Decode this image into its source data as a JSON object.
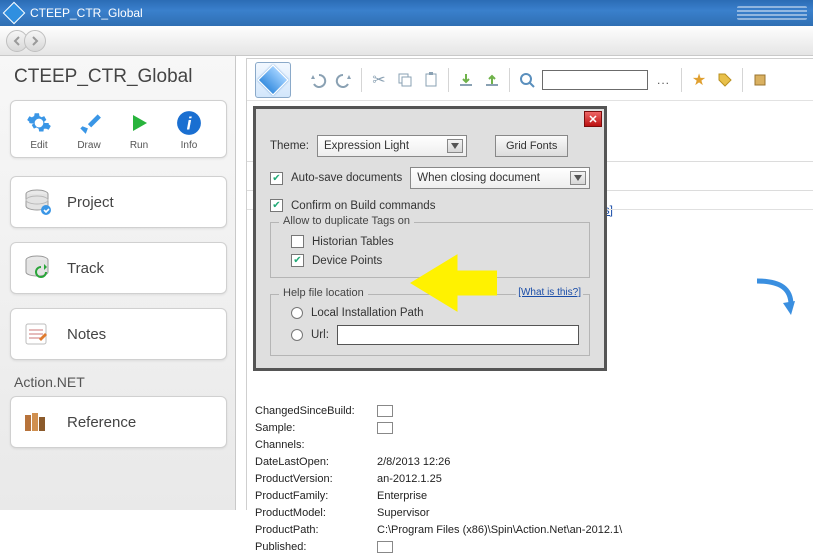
{
  "titlebar": {
    "title": "CTEEP_CTR_Global"
  },
  "left": {
    "title": "CTEEP_CTR_Global",
    "icons": {
      "edit": "Edit",
      "draw": "Draw",
      "run": "Run",
      "info": "Info"
    },
    "cards": {
      "project": "Project",
      "track": "Track",
      "notes": "Notes",
      "reference": "Reference"
    },
    "section": "Action.NET"
  },
  "toolbar": {
    "search_placeholder": "",
    "more": "..."
  },
  "pref": {
    "theme_label": "Theme:",
    "theme_value": "Expression Light",
    "grid_fonts": "Grid Fonts",
    "autosave": "Auto-save documents",
    "autosave_mode": "When closing document",
    "confirm": "Confirm on Build commands",
    "dup_label": "Allow to duplicate Tags on",
    "dup_hist": "Historian Tables",
    "dup_dev": "Device Points",
    "help_label": "Help file location",
    "what": "[What is this?]",
    "help_local": "Local Installation Path",
    "help_url": "Url:"
  },
  "info_link": "s]",
  "pv": {
    "changed": "ChangedSinceBuild:",
    "sample": "Sample:",
    "channels": "Channels:",
    "dlo_k": "DateLastOpen:",
    "dlo_v": "2/8/2013 12:26",
    "pver_k": "ProductVersion:",
    "pver_v": "an-2012.1.25",
    "pfam_k": "ProductFamily:",
    "pfam_v": "Enterprise",
    "pmodel_k": "ProductModel:",
    "pmodel_v": "Supervisor",
    "ppath_k": "ProductPath:",
    "ppath_v": "C:\\Program Files (x86)\\Spin\\Action.Net\\an-2012.1\\",
    "pub_k": "Published:"
  }
}
